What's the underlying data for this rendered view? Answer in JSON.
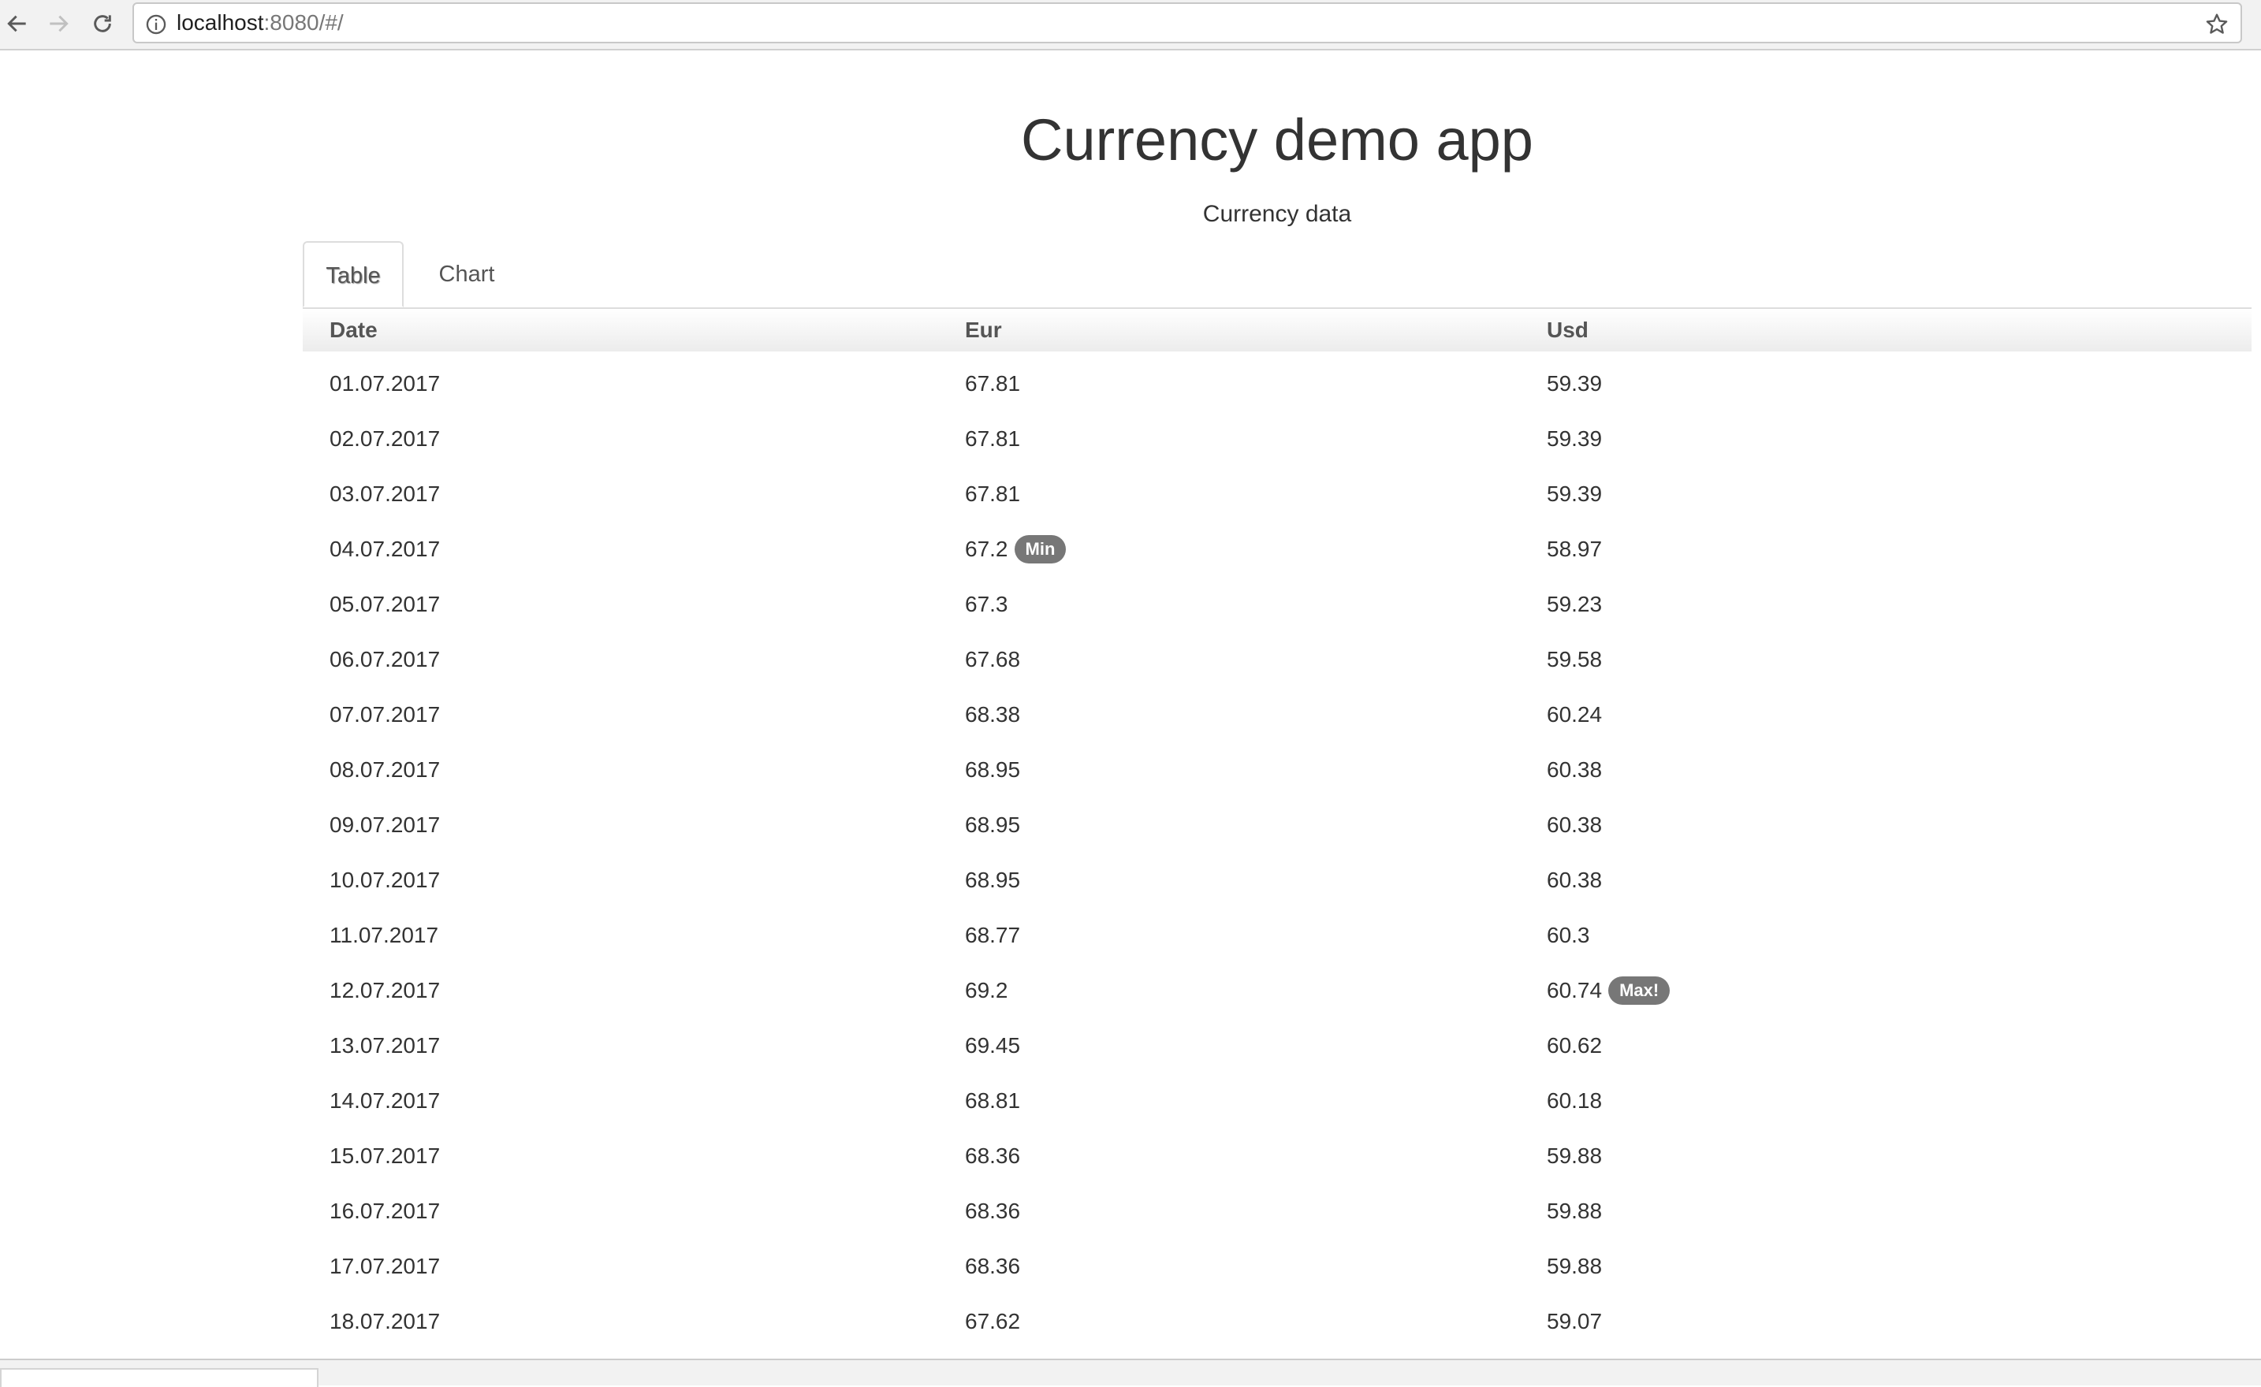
{
  "browser": {
    "url_host": "localhost",
    "url_path": ":8080/#/"
  },
  "page": {
    "title": "Currency demo app",
    "subtitle": "Currency data"
  },
  "tabs": [
    "Table",
    "Chart"
  ],
  "table": {
    "columns": [
      "Date",
      "Eur",
      "Usd"
    ],
    "rows": [
      {
        "date": "01.07.2017",
        "eur": "67.81",
        "usd": "59.39"
      },
      {
        "date": "02.07.2017",
        "eur": "67.81",
        "usd": "59.39"
      },
      {
        "date": "03.07.2017",
        "eur": "67.81",
        "usd": "59.39"
      },
      {
        "date": "04.07.2017",
        "eur": "67.2",
        "eur_badge": "Min",
        "usd": "58.97"
      },
      {
        "date": "05.07.2017",
        "eur": "67.3",
        "usd": "59.23"
      },
      {
        "date": "06.07.2017",
        "eur": "67.68",
        "usd": "59.58"
      },
      {
        "date": "07.07.2017",
        "eur": "68.38",
        "usd": "60.24"
      },
      {
        "date": "08.07.2017",
        "eur": "68.95",
        "usd": "60.38"
      },
      {
        "date": "09.07.2017",
        "eur": "68.95",
        "usd": "60.38"
      },
      {
        "date": "10.07.2017",
        "eur": "68.95",
        "usd": "60.38"
      },
      {
        "date": "11.07.2017",
        "eur": "68.77",
        "usd": "60.3"
      },
      {
        "date": "12.07.2017",
        "eur": "69.2",
        "usd": "60.74",
        "usd_badge": "Max!"
      },
      {
        "date": "13.07.2017",
        "eur": "69.45",
        "usd": "60.62"
      },
      {
        "date": "14.07.2017",
        "eur": "68.81",
        "usd": "60.18"
      },
      {
        "date": "15.07.2017",
        "eur": "68.36",
        "usd": "59.88"
      },
      {
        "date": "16.07.2017",
        "eur": "68.36",
        "usd": "59.88"
      },
      {
        "date": "17.07.2017",
        "eur": "68.36",
        "usd": "59.88"
      },
      {
        "date": "18.07.2017",
        "eur": "67.62",
        "usd": "59.07"
      }
    ]
  }
}
